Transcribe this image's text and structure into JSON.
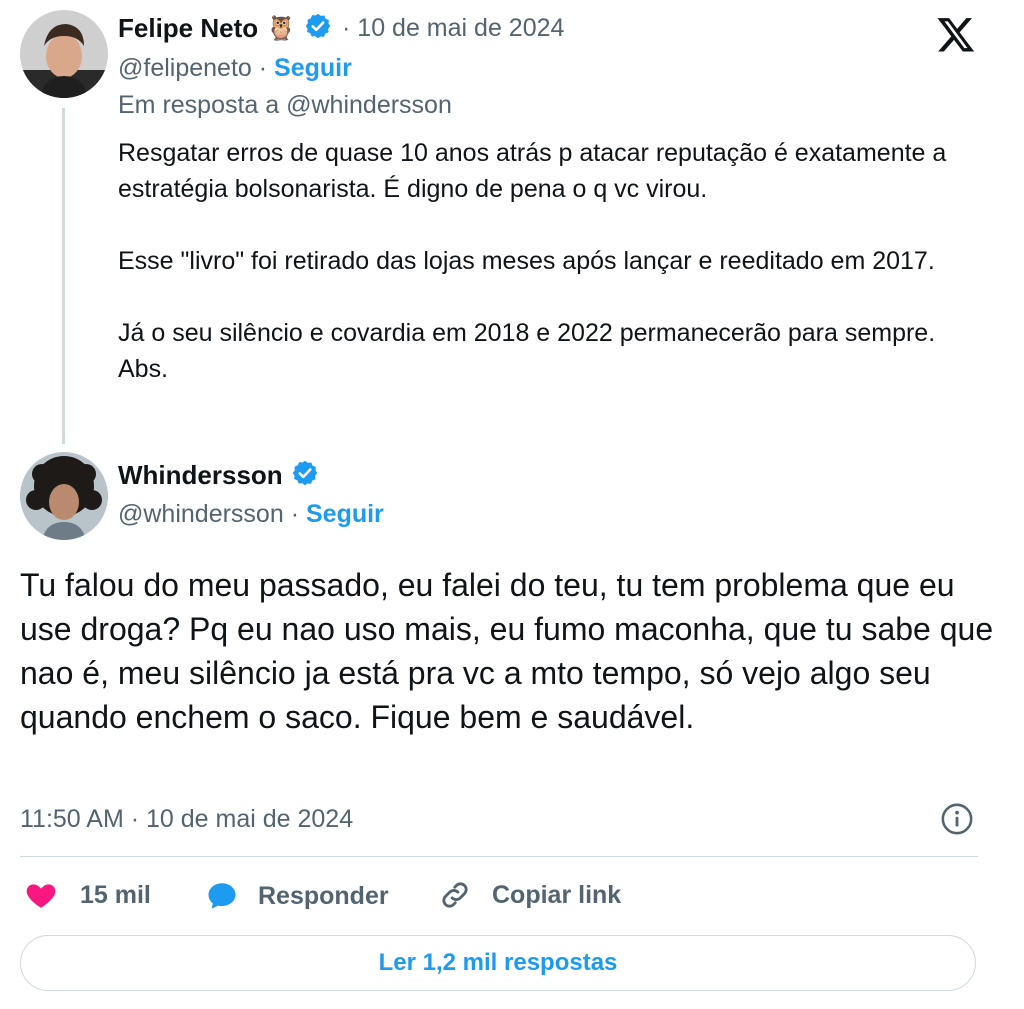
{
  "reply_tweet": {
    "name": "Felipe Neto",
    "badge_emoji": "🦉",
    "date": "· 10 de mai de 2024",
    "handle": "@felipeneto",
    "follow_sep": "·",
    "follow": "Seguir",
    "reply_to": "Em resposta a @whindersson",
    "paragraphs": [
      "Resgatar erros de quase 10 anos atrás p atacar reputação é exatamente a estratégia bolsonarista. É digno de pena o q vc virou.",
      "Esse \"livro\" foi retirado das lojas meses após lançar e reeditado em 2017.",
      "Já o seu silêncio e covardia em 2018 e 2022 permanecerão para sempre. Abs."
    ]
  },
  "main_tweet": {
    "name": "Whindersson",
    "handle": "@whindersson",
    "follow_sep": "·",
    "follow": "Seguir",
    "text": "Tu falou do meu passado, eu falei do teu, tu tem problema que eu use droga? Pq eu nao uso mais, eu fumo maconha, que tu sabe que nao é, meu silêncio ja está pra vc a mto tempo, só vejo algo seu quando enchem o saco. Fique bem e saudável.",
    "timestamp": "11:50 AM · 10 de mai de 2024"
  },
  "actions": {
    "likes": "15 mil",
    "reply": "Responder",
    "copy_link": "Copiar link"
  },
  "read_replies": "Ler 1,2 mil respostas",
  "colors": {
    "accent": "#1d9bf0",
    "like": "#f91880",
    "muted": "#536471",
    "border": "#cfd9de"
  },
  "icons": [
    "x-logo-icon",
    "verified-badge-icon",
    "info-icon",
    "heart-icon",
    "reply-bubble-icon",
    "link-icon"
  ]
}
